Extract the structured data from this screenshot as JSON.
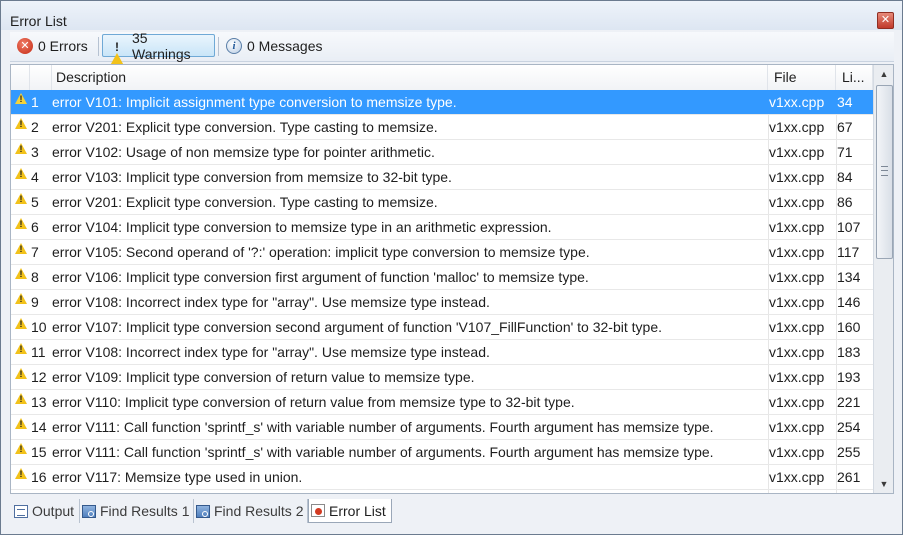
{
  "window": {
    "title": "Error List"
  },
  "toolbar": {
    "errors_label": "0 Errors",
    "warnings_label": "35 Warnings",
    "messages_label": "0 Messages"
  },
  "columns": {
    "description": "Description",
    "file": "File",
    "line": "Li..."
  },
  "rows": [
    {
      "num": "1",
      "desc": "error V101: Implicit assignment type conversion to memsize type.",
      "file": "v1xx.cpp",
      "line": "34"
    },
    {
      "num": "2",
      "desc": "error V201: Explicit type conversion. Type casting to memsize.",
      "file": "v1xx.cpp",
      "line": "67"
    },
    {
      "num": "3",
      "desc": "error V102: Usage of non memsize type for pointer arithmetic.",
      "file": "v1xx.cpp",
      "line": "71"
    },
    {
      "num": "4",
      "desc": "error V103: Implicit type conversion from memsize to 32-bit type.",
      "file": "v1xx.cpp",
      "line": "84"
    },
    {
      "num": "5",
      "desc": "error V201: Explicit type conversion. Type casting to memsize.",
      "file": "v1xx.cpp",
      "line": "86"
    },
    {
      "num": "6",
      "desc": "error V104: Implicit type conversion to memsize type in an arithmetic expression.",
      "file": "v1xx.cpp",
      "line": "107"
    },
    {
      "num": "7",
      "desc": "error V105: Second operand of '?:' operation: implicit type conversion to memsize type.",
      "file": "v1xx.cpp",
      "line": "117"
    },
    {
      "num": "8",
      "desc": "error V106: Implicit type conversion first argument of function 'malloc' to memsize type.",
      "file": "v1xx.cpp",
      "line": "134"
    },
    {
      "num": "9",
      "desc": "error V108: Incorrect index type for \"array\". Use memsize type instead.",
      "file": "v1xx.cpp",
      "line": "146"
    },
    {
      "num": "10",
      "desc": "error V107: Implicit type conversion second argument of function 'V107_FillFunction' to 32-bit type.",
      "file": "v1xx.cpp",
      "line": "160"
    },
    {
      "num": "11",
      "desc": "error V108: Incorrect index type for \"array\". Use memsize type instead.",
      "file": "v1xx.cpp",
      "line": "183"
    },
    {
      "num": "12",
      "desc": "error V109: Implicit type conversion of return value to memsize type.",
      "file": "v1xx.cpp",
      "line": "193"
    },
    {
      "num": "13",
      "desc": "error V110: Implicit type conversion of return value from memsize type to 32-bit type.",
      "file": "v1xx.cpp",
      "line": "221"
    },
    {
      "num": "14",
      "desc": "error V111: Call function 'sprintf_s' with variable number of arguments. Fourth argument has memsize type.",
      "file": "v1xx.cpp",
      "line": "254"
    },
    {
      "num": "15",
      "desc": "error V111: Call function 'sprintf_s' with variable number of arguments. Fourth argument has memsize type.",
      "file": "v1xx.cpp",
      "line": "255"
    },
    {
      "num": "16",
      "desc": "error V117: Memsize type used in union.",
      "file": "v1xx.cpp",
      "line": "261"
    }
  ],
  "tabs": [
    {
      "label": "Output",
      "icon": "output-icon"
    },
    {
      "label": "Find Results 1",
      "icon": "find-results-icon"
    },
    {
      "label": "Find Results 2",
      "icon": "find-results-icon"
    },
    {
      "label": "Error List",
      "icon": "error-list-icon"
    }
  ],
  "colors": {
    "selection": "#3399ff",
    "warning": "#f2c21a",
    "error": "#c42a14"
  }
}
